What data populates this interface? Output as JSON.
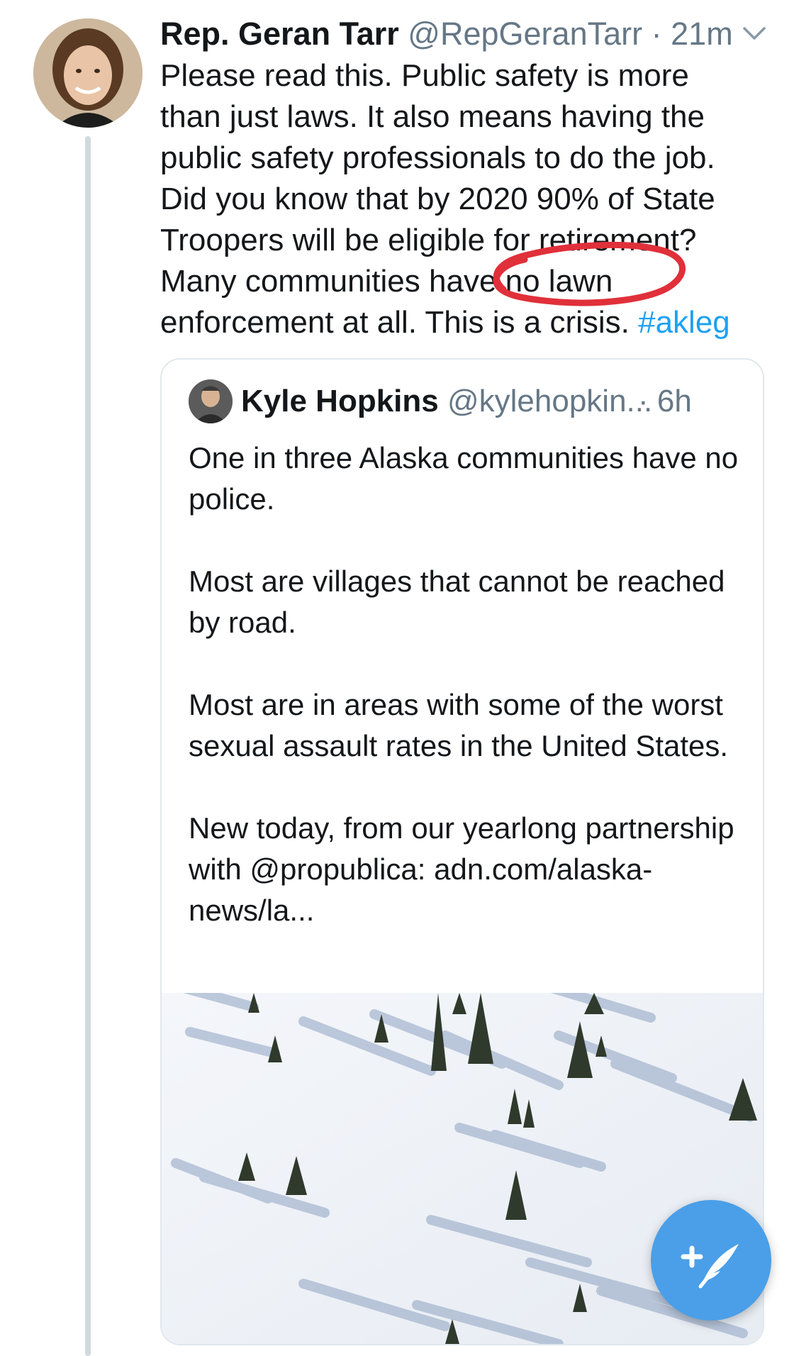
{
  "tweet": {
    "author_name": "Rep. Geran Tarr",
    "author_handle": "@RepGeranTarr",
    "separator": "·",
    "time": "21m",
    "text_lines": [
      "Please read this. Public safety is more",
      "than just laws. It also means having the",
      "public safety professionals to do the job.",
      "Did you know that by 2020 90% of State",
      "Troopers will be eligible for retirement?",
      "Many communities have no lawn",
      "enforcement at all. This is a crisis."
    ],
    "hashtag": "#akleg"
  },
  "quoted_tweet": {
    "author_name": "Kyle Hopkins",
    "author_handle": "@kylehopkin...",
    "time": "· 6h",
    "paragraphs": [
      "One in three Alaska communities have no police.",
      "Most are villages that cannot be reached by road.",
      "Most are in areas with some of the worst sexual assault rates in the United States.",
      "New today, from our yearlong partnership with @propublica: adn.com/alaska-news/la..."
    ]
  },
  "icons": {
    "chevron": "chevron-down-icon",
    "compose": "compose-tweet-icon"
  },
  "colors": {
    "link": "#1da1f2",
    "secondary_text": "#657786",
    "thread_line": "#cfd9de",
    "card_border": "#e1e8ed",
    "fab": "#4a9fe8",
    "annotation": "#e0303a"
  }
}
